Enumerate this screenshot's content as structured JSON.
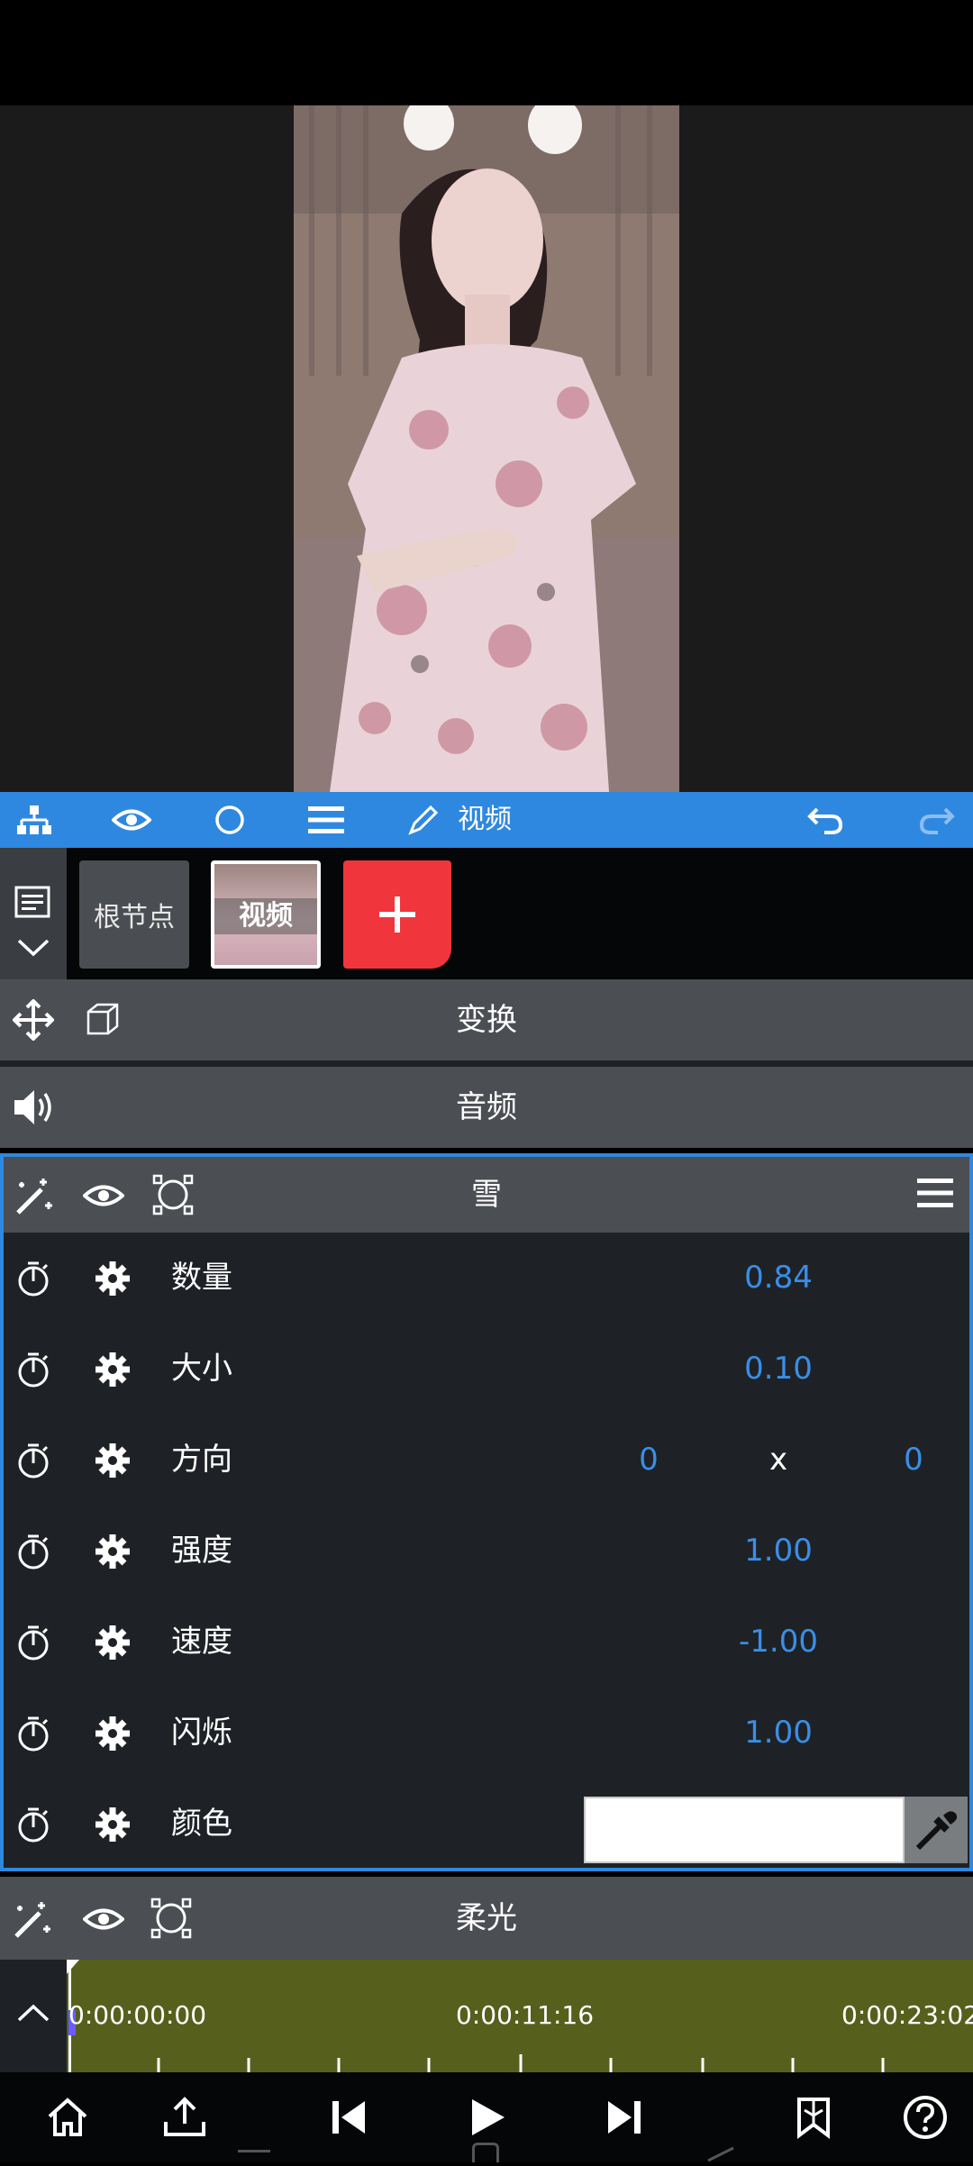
{
  "toolbar": {
    "title": "视频",
    "icons": [
      "hierarchy-icon",
      "eye-icon",
      "circle-icon",
      "menu-icon",
      "pencil-icon",
      "undo-icon",
      "redo-icon"
    ],
    "accent": "#2f88e0"
  },
  "layers": {
    "root_label": "根节点",
    "video_label": "视频",
    "add_label": "+",
    "add_color": "#f0363c"
  },
  "sections": {
    "transform": "变换",
    "audio": "音频",
    "snow": "雪",
    "softlight": "柔光"
  },
  "params": [
    {
      "label": "数量",
      "value": "0.84"
    },
    {
      "label": "大小",
      "value": "0.10"
    },
    {
      "label": "方向",
      "value_x": "0",
      "sep": "x",
      "value_y": "0"
    },
    {
      "label": "强度",
      "value": "1.00"
    },
    {
      "label": "速度",
      "value": "-1.00"
    },
    {
      "label": "闪烁",
      "value": "1.00"
    },
    {
      "label": "颜色",
      "color": "#ffffff"
    }
  ],
  "timeline": {
    "start": "0:00:00:00",
    "mid": "0:00:11:16",
    "end": "0:00:23:02",
    "color": "#56601c"
  },
  "bottom_bar": {
    "icons": [
      "home-icon",
      "export-icon",
      "skip-back-icon",
      "play-icon",
      "skip-forward-icon",
      "bookmark-icon",
      "help-icon"
    ]
  }
}
